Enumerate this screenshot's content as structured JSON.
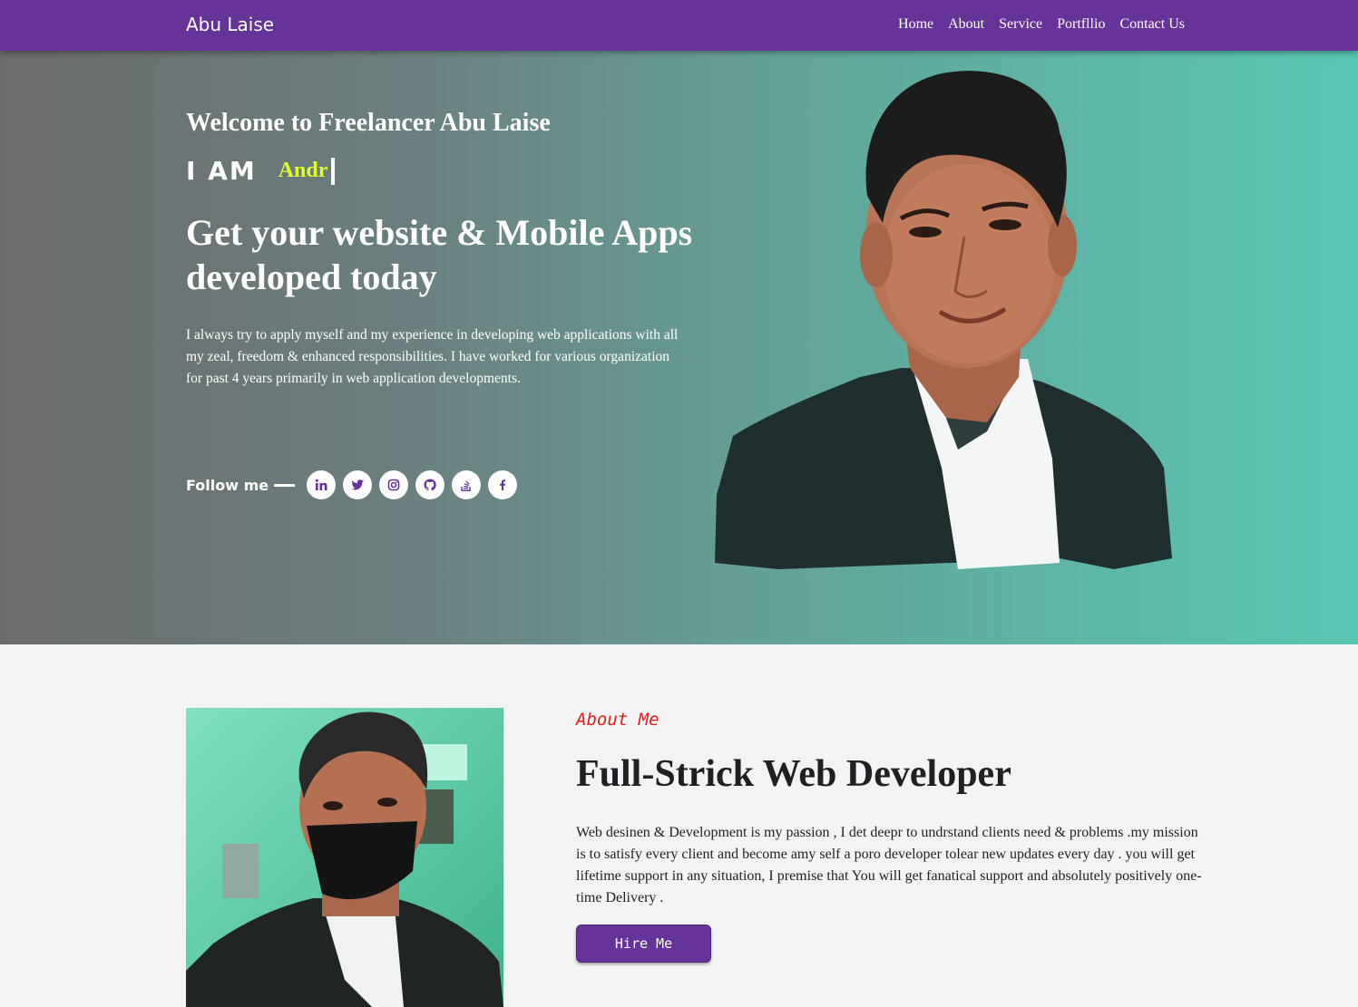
{
  "navbar": {
    "brand": "Abu Laise",
    "links": [
      "Home",
      "About",
      "Service",
      "Portfllio",
      "Contact Us"
    ]
  },
  "hero": {
    "welcome": "Welcome to Freelancer Abu Laise",
    "iam_label": "I AM",
    "typed_role": "Andr",
    "headline": "Get your website & Mobile Apps developed today",
    "description": "I always try to apply myself and my experience in developing web applications with all my zeal, freedom & enhanced responsibilities. I have worked for various organization for past 4 years primarily in web application developments.",
    "follow_label": "Follow me",
    "socials": [
      "linkedin-icon",
      "twitter-icon",
      "instagram-icon",
      "github-icon",
      "stackoverflow-icon",
      "facebook-icon"
    ]
  },
  "about": {
    "tag": "About Me",
    "title": "Full-Strick Web Developer",
    "description": "Web desinen & Development is my passion , I det deepr to undrstand clients need & problems .my mission is to satisfy every client and become amy self a poro developer tolear new updates every day . you will get lifetime support in any situation, I premise that You will get fanatical support and absolutely positively one-time Delivery .",
    "button": "Hire Me"
  },
  "colors": {
    "brand_purple": "#663399",
    "accent_yellow": "#dfff2d",
    "about_tag_red": "#e11d1d",
    "hero_gradient_start": "#6b6b6b",
    "hero_gradient_end": "#58c7b3"
  }
}
